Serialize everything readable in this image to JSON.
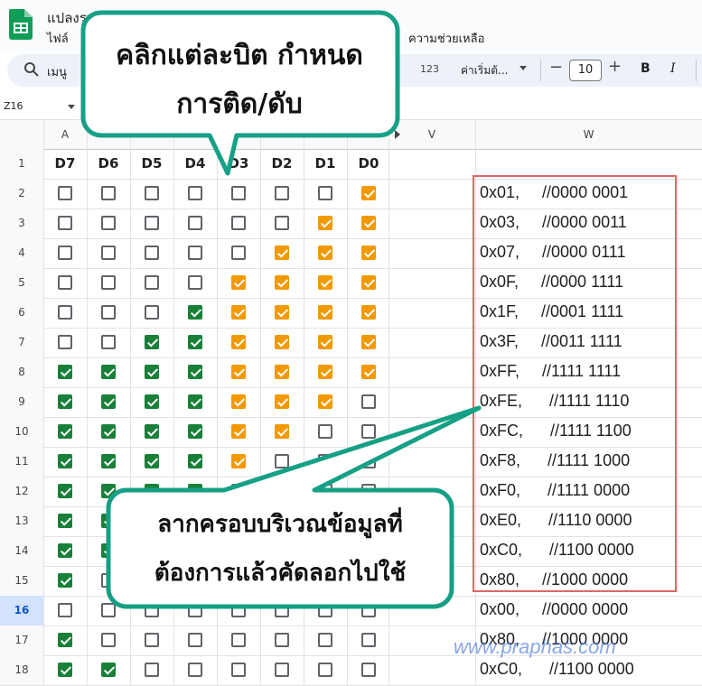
{
  "header": {
    "doc_title": "แปลงรูป",
    "menu_file": "ไฟล์",
    "menu_help": "ความช่วยเหลือ"
  },
  "toolbar": {
    "search_label": "เมนู",
    "format_123": "123",
    "font_name": "ค่าเริ่มต้...",
    "font_size": "10",
    "minus": "−",
    "plus": "+",
    "bold": "B",
    "italic": "I"
  },
  "namebox": "Z16",
  "columns": [
    "A",
    "V",
    "W"
  ],
  "rows": [
    "1",
    "2",
    "3",
    "4",
    "5",
    "6",
    "7",
    "8",
    "9",
    "10",
    "11",
    "12",
    "13",
    "14",
    "15",
    "16",
    "17",
    "18"
  ],
  "active_row": "16",
  "bit_labels": [
    "D7",
    "D6",
    "D5",
    "D4",
    "D3",
    "D2",
    "D1",
    "D0"
  ],
  "bits": [
    [
      0,
      0,
      0,
      0,
      0,
      0,
      0,
      1
    ],
    [
      0,
      0,
      0,
      0,
      0,
      0,
      1,
      1
    ],
    [
      0,
      0,
      0,
      0,
      0,
      1,
      1,
      1
    ],
    [
      0,
      0,
      0,
      0,
      1,
      1,
      1,
      1
    ],
    [
      0,
      0,
      0,
      1,
      1,
      1,
      1,
      1
    ],
    [
      0,
      0,
      1,
      1,
      1,
      1,
      1,
      1
    ],
    [
      1,
      1,
      1,
      1,
      1,
      1,
      1,
      1
    ],
    [
      1,
      1,
      1,
      1,
      1,
      1,
      1,
      0
    ],
    [
      1,
      1,
      1,
      1,
      1,
      1,
      0,
      0
    ],
    [
      1,
      1,
      1,
      1,
      1,
      0,
      0,
      0
    ],
    [
      1,
      1,
      1,
      1,
      0,
      0,
      0,
      0
    ],
    [
      1,
      1,
      1,
      0,
      0,
      0,
      0,
      0
    ],
    [
      1,
      1,
      0,
      0,
      0,
      0,
      0,
      0
    ],
    [
      1,
      0,
      0,
      0,
      0,
      0,
      0,
      0
    ],
    [
      0,
      0,
      0,
      0,
      0,
      0,
      0,
      0
    ],
    [
      1,
      0,
      0,
      0,
      0,
      0,
      0,
      0
    ],
    [
      1,
      1,
      0,
      0,
      0,
      0,
      0,
      0
    ]
  ],
  "w_values": [
    "0x01,     //0000 0001",
    "0x03,     //0000 0011",
    "0x07,     //0000 0111",
    "0x0F,     //0000 1111",
    "0x1F,     //0001 1111",
    "0x3F,     //0011 1111",
    "0xFF,     //1111 1111",
    "0xFE,      //1111 1110",
    "0xFC,      //1111 1100",
    "0xF8,      //1111 1000",
    "0xF0,      //1111 0000",
    "0xE0,      //1110 0000",
    "0xC0,      //1100 0000",
    "0x80,     //1000 0000",
    "0x00,     //0000 0000",
    "0x80,     //1000 0000",
    "0xC0,      //1100 0000"
  ],
  "callout_top": [
    "คลิกแต่ละบิต กำหนด",
    "การติด/ดับ"
  ],
  "callout_bottom": [
    "ลากครอบบริเวณข้อมูลที่",
    "ต้องการแล้วคัดลอกไปใช้"
  ],
  "watermark": "www.praphas.com",
  "colors": {
    "checkbox_green": "#188038",
    "checkbox_orange": "#f29900",
    "callout_border": "#16a085",
    "highlight_box": "#e06666",
    "sheets_green": "#0f9d58"
  }
}
